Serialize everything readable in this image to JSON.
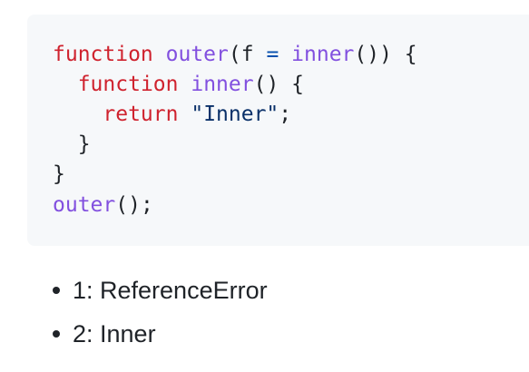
{
  "code": {
    "line1": {
      "kw": "function",
      "name": "outer",
      "open": "(f",
      "eq": "=",
      "call": "inner",
      "close": "()) {"
    },
    "line2": {
      "kw": "function",
      "name": "inner",
      "rest": "() {"
    },
    "line3": {
      "kw": "return",
      "str": "\"Inner\"",
      "semi": ";"
    },
    "line4": {
      "text": "}"
    },
    "line5": {
      "text": "}"
    },
    "line6": {
      "name": "outer",
      "rest": "();"
    }
  },
  "options": [
    {
      "text": "1: ReferenceError"
    },
    {
      "text": "2: Inner"
    }
  ],
  "colors": {
    "keyword": "#cf222e",
    "function": "#8250df",
    "operator": "#0550ae",
    "string": "#0a3069",
    "plain": "#1f2328",
    "code_background": "#f6f8fa"
  }
}
